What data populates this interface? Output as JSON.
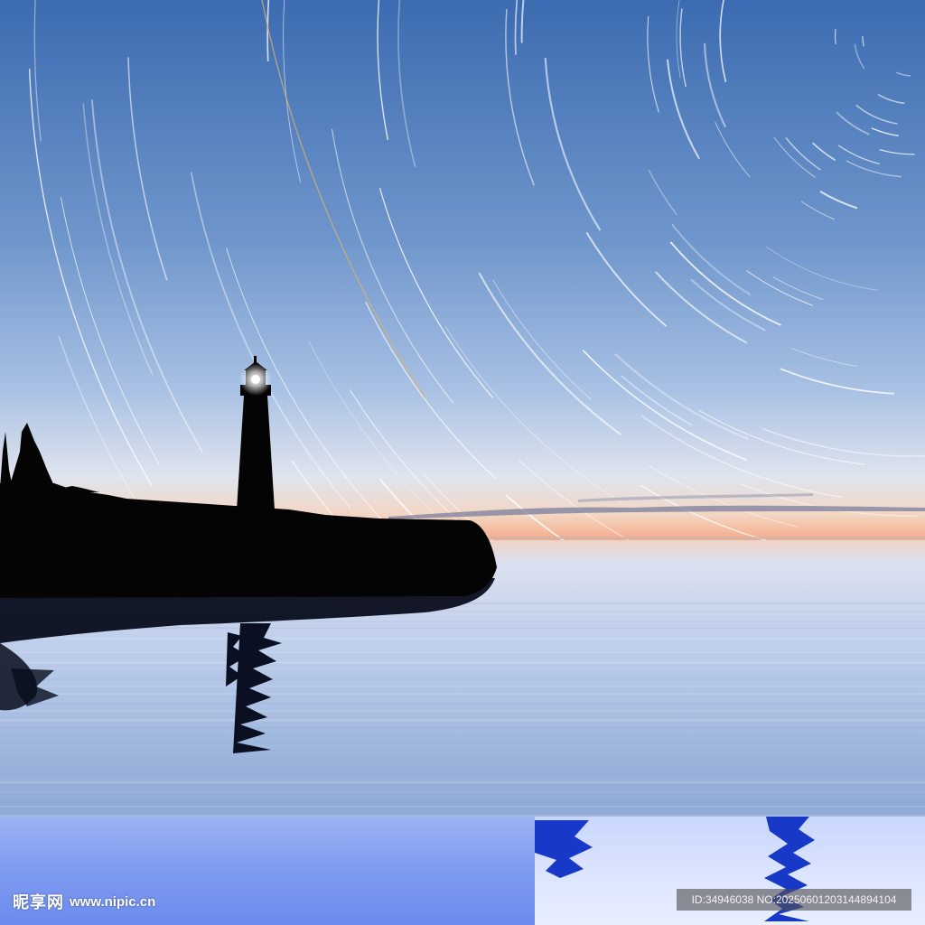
{
  "image": {
    "subject": "lighthouse",
    "colors": {
      "sky_top": "#3f6fb3",
      "sky_mid": "#86a6d4",
      "horizon_glow": "#f2b08c",
      "water": "#a9c1e6",
      "silhouette": "#050505",
      "band_left": "#6f8ff0",
      "band_right": "#dfe7ff"
    }
  },
  "watermark": {
    "site_name_cn": "昵享网",
    "site_url": "www.nipic.cn",
    "id_text": "ID:34946038 NO:20250601203144894104"
  }
}
